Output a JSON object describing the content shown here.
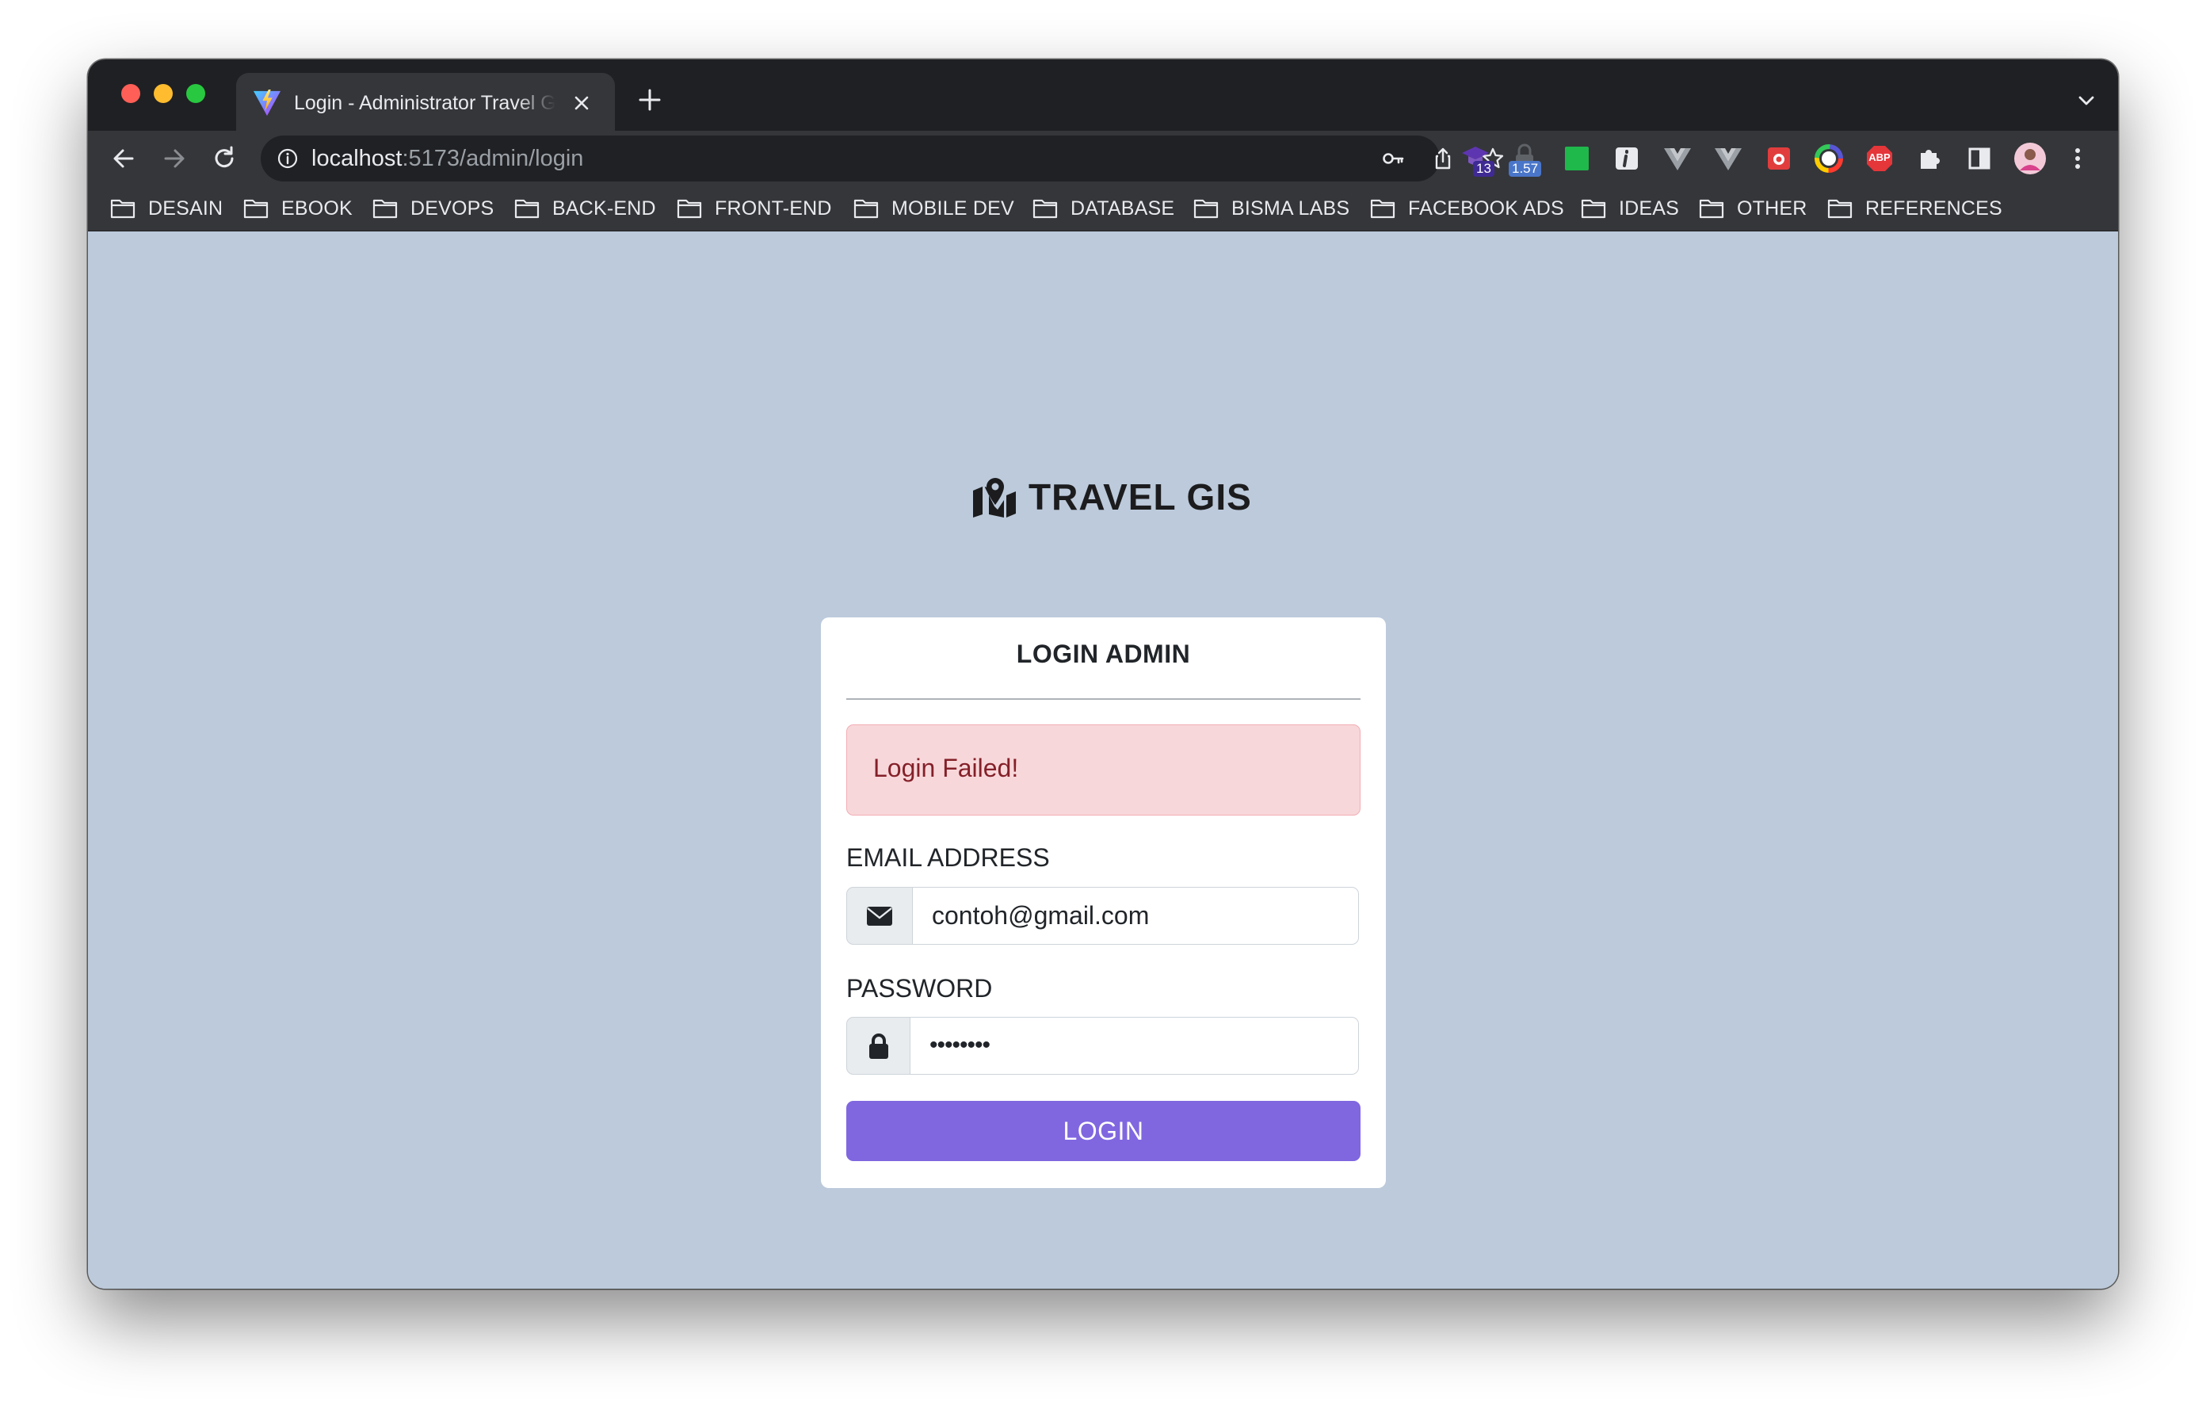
{
  "browser": {
    "tab": {
      "title": "Login - Administrator Travel GIS"
    },
    "address_bar": {
      "host": "localhost",
      "path": ":5173/admin/login"
    },
    "extensions": [
      {
        "name": "graduation-cap-extension",
        "badge": "13"
      },
      {
        "name": "lock-extension",
        "badge": "1.57"
      },
      {
        "name": "green-square-extension"
      },
      {
        "name": "info-extension"
      },
      {
        "name": "vue-devtools-extension"
      },
      {
        "name": "vue-devtools-extension-2"
      },
      {
        "name": "red-bug-extension"
      },
      {
        "name": "color-picker-extension"
      },
      {
        "name": "adblock-plus-extension",
        "label": "ABP"
      },
      {
        "name": "extensions-puzzle"
      },
      {
        "name": "side-panel"
      },
      {
        "name": "profile-avatar"
      },
      {
        "name": "menu-kebab"
      }
    ],
    "bookmarks": [
      "DESAIN",
      "EBOOK",
      "DEVOPS",
      "BACK-END",
      "FRONT-END",
      "MOBILE DEV",
      "DATABASE",
      "BISMA LABS",
      "FACEBOOK ADS",
      "IDEAS",
      "OTHER",
      "REFERENCES"
    ]
  },
  "page": {
    "brand": "TRAVEL GIS",
    "card_title": "LOGIN ADMIN",
    "alert": "Login Failed!",
    "email": {
      "label": "EMAIL ADDRESS",
      "value": "contoh@gmail.com"
    },
    "password": {
      "label": "PASSWORD",
      "value": "••••••••"
    },
    "submit_label": "LOGIN"
  },
  "colors": {
    "page_bg": "#bccadb",
    "alert_bg": "#f8d7da",
    "alert_text": "#842029",
    "button_bg": "#8067e0"
  }
}
